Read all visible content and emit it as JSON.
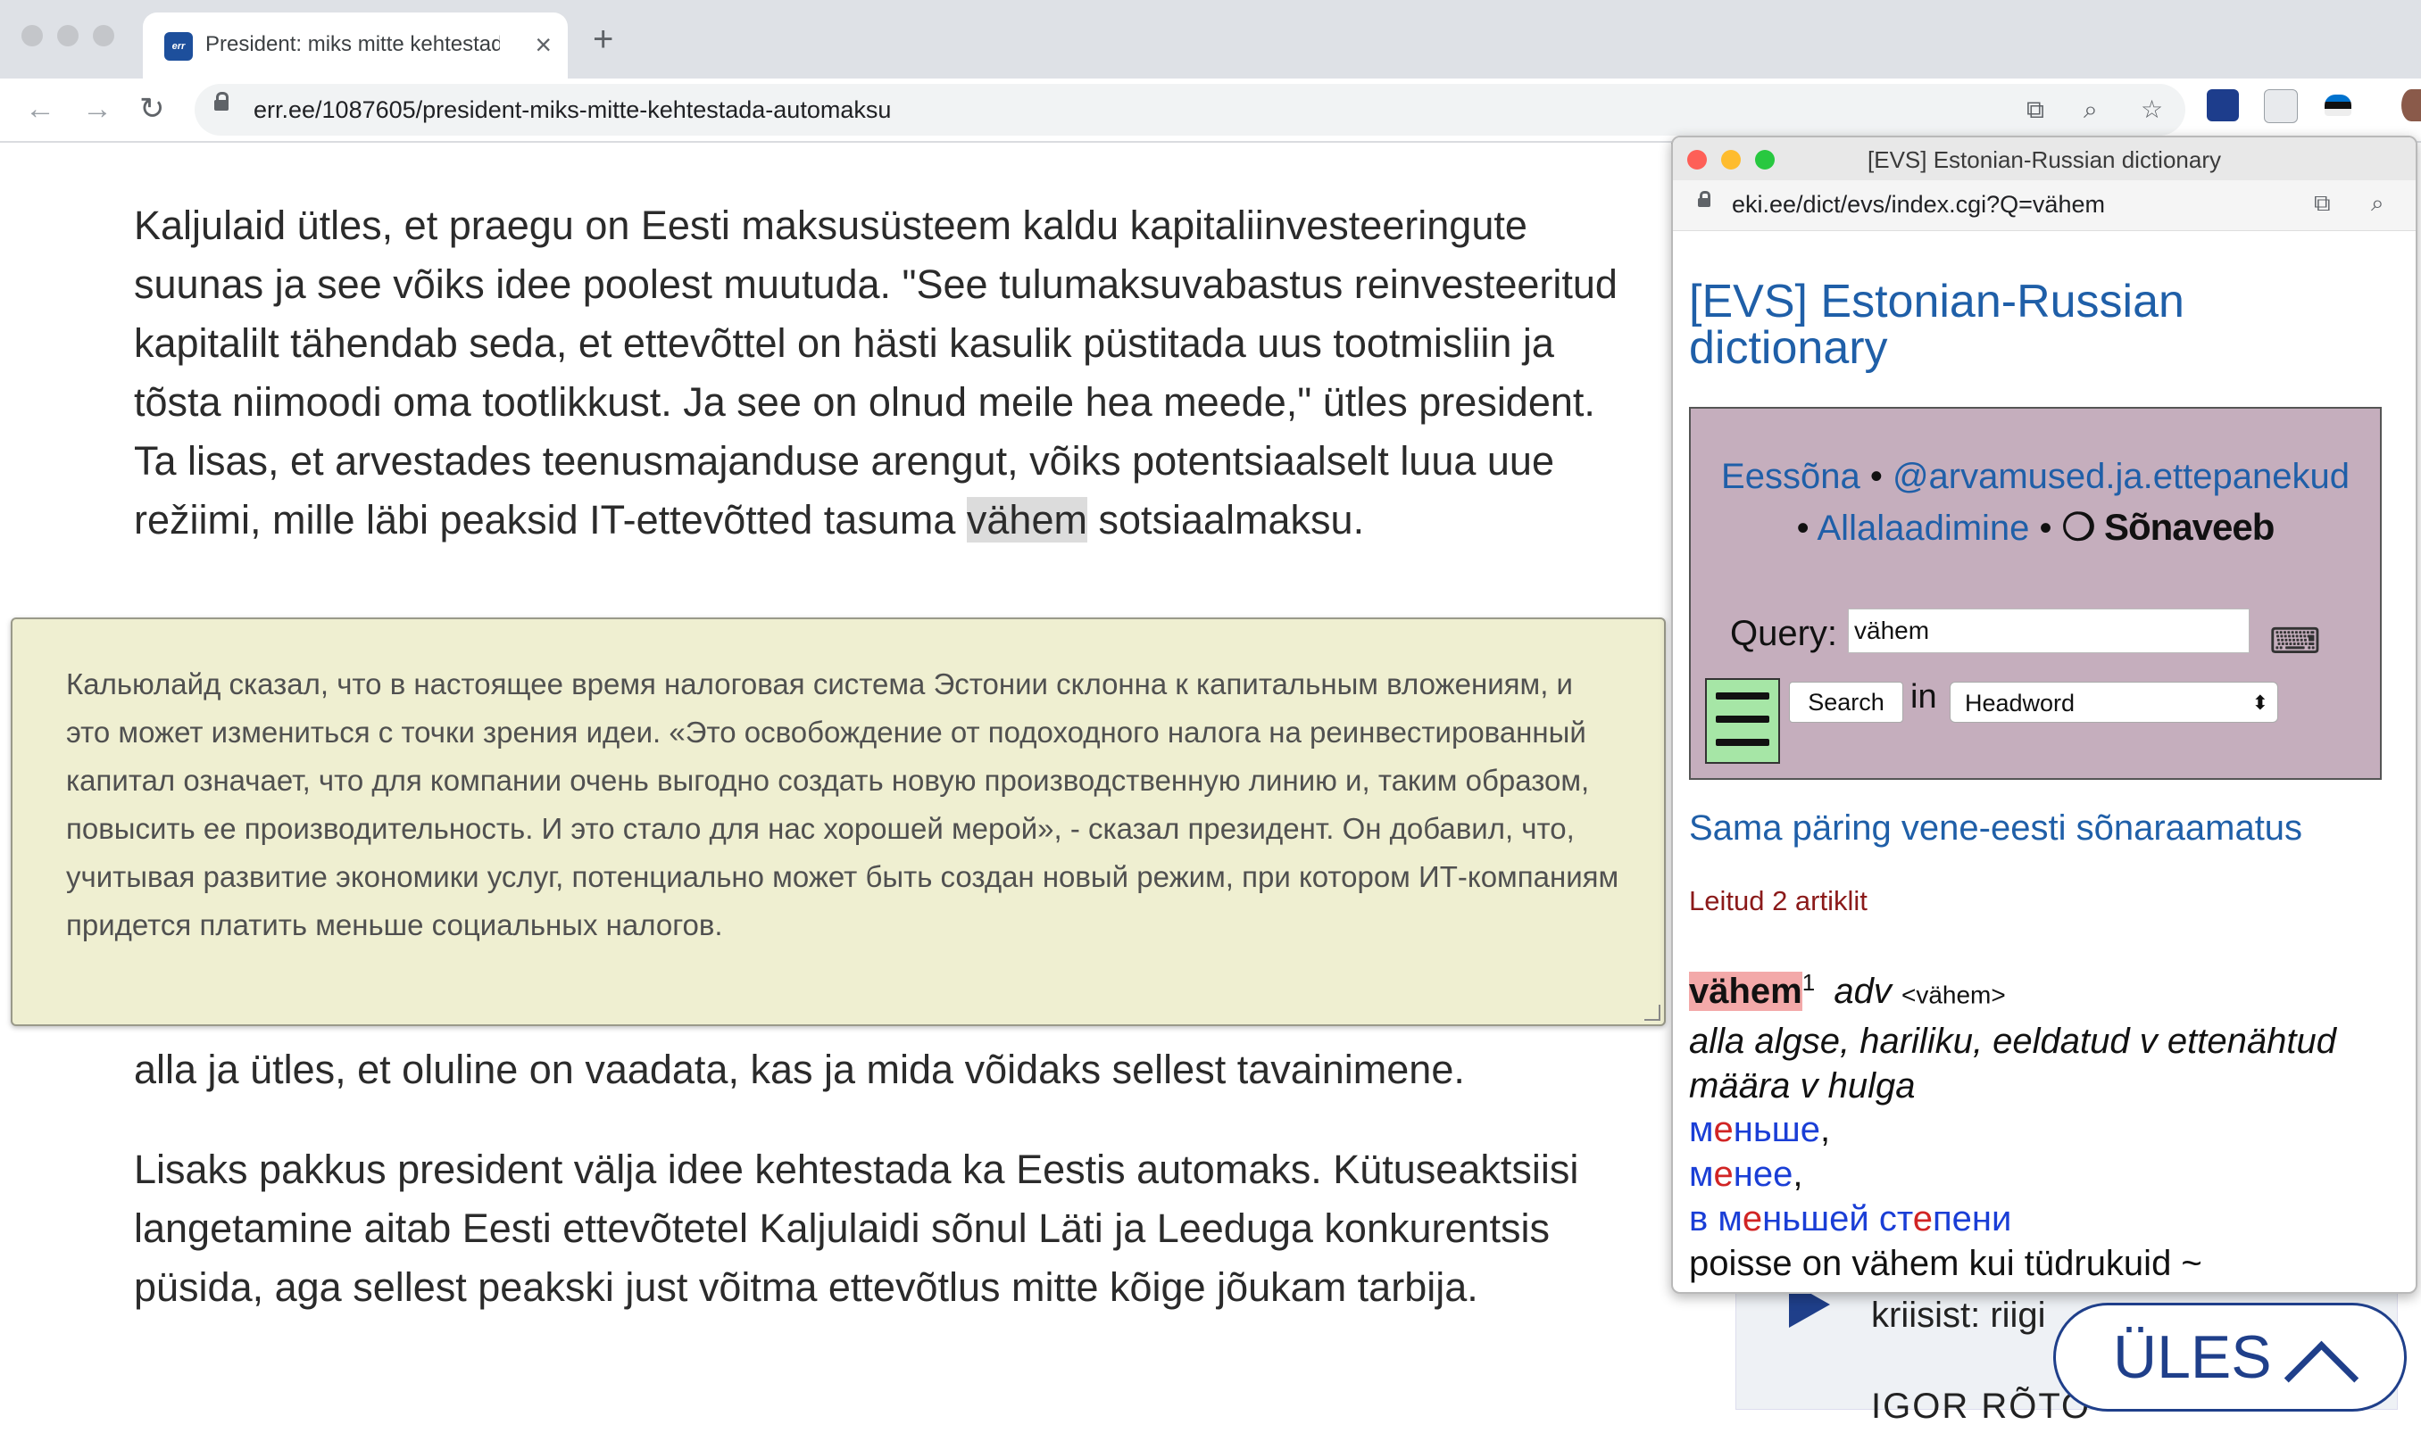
{
  "browser": {
    "tab_title": "President: miks mitte kehtestada automaksu",
    "url": "err.ee/1087605/president-miks-mitte-kehtestada-automaksu",
    "favicon_text": "err"
  },
  "article": {
    "paragraph_1": "Kaljulaid ütles, et praegu on Eesti maksusüsteem kaldu kapitaliinvesteeringute suunas ja see võiks idee poolest muutuda. \"See tulumaksuvabastus reinvesteeritud kapitalilt tähendab seda, et ettevõttel on hästi kasulik püstitada uus tootmisliin ja tõsta niimoodi oma tootlikkust. Ja see on olnud meile hea meede,\" ütles president. Ta lisas, et arvestades teenusmajanduse arengut, võiks potentsiaalselt luua uue režiimi, mille läbi peaksid IT-ettevõtted tasuma",
    "highlighted_word": "vähem",
    "paragraph_1_end": " sotsiaalmaksu.",
    "paragraph_2_tail": "alla ja ütles, et oluline on vaadata, kas ja mida võidaks sellest tavainimene.",
    "paragraph_3": "Lisaks pakkus president välja idee kehtestada ka Eestis automaks. Kütuseaktsiisi langetamine aitab Eesti ettevõtetel Kaljulaidi sõnul Läti ja Leeduga konkurentsis püsida, aga sellest peakski just võitma ettevõtlus mitte kõige jõukam tarbija."
  },
  "translation": {
    "text": "Кальюлайд сказал, что в настоящее время налоговая система Эстонии склонна к капитальным вложениям, и это может измениться с точки зрения идеи. «Это освобождение от подоходного налога на реинвестированный капитал означает, что для компании очень выгодно создать новую производственную линию и, таким образом, повысить ее производительность. И это стало для нас хорошей мерой», - сказал президент. Он добавил, что, учитывая развитие экономики услуг, потенциально может быть создан новый режим, при котором ИТ-компаниям придется платить меньше социальных налогов."
  },
  "dictionary": {
    "window_title": "[EVS] Estonian-Russian dictionary",
    "url": "eki.ee/dict/evs/index.cgi?Q=vähem",
    "heading": "[EVS] Estonian-Russian dictionary",
    "links": {
      "eessona": "Eessõna",
      "feedback": "@arvamused.ja.ettepanekud",
      "download": "Allalaadimine",
      "sonaveeb": "Sõnaveeb",
      "separator": " • "
    },
    "query_label": "Query:",
    "query_value": "vähem",
    "search_label": "Search",
    "in_label": "in",
    "field_selected": "Headword",
    "reverse_link": "Sama päring vene-eesti sõnaraamatus",
    "found": "Leitud 2 artiklit",
    "entry": {
      "headword": "vähem",
      "sup": "1",
      "pos": "adv",
      "form": "<vähem>",
      "definition": "alla algse, hariliku, eeldatud v ettenähtud määra v hulga",
      "translations": [
        {
          "pre": "м",
          "stress": "е",
          "post": "ньше",
          "sep": ","
        },
        {
          "pre": "м",
          "stress": "е",
          "post": "нее",
          "sep": ","
        },
        {
          "pre": "в м",
          "stress": "е",
          "post": "ньшей ст",
          "stress2": "е",
          "post2": "пени"
        }
      ],
      "example": "poisse on vähem kui tüdrukuid ~"
    }
  },
  "behind": {
    "text1": "kriisist: riigi",
    "text2": "IGOR RÕTO"
  },
  "scroll_top": {
    "label": "ÜLES"
  },
  "colors": {
    "link_blue": "#1f5fa8",
    "box_bg": "#c5aebd",
    "translation_bg": "#efefd1",
    "headword_bg": "#f3a9a9",
    "ules_blue": "#1f3f8a"
  }
}
